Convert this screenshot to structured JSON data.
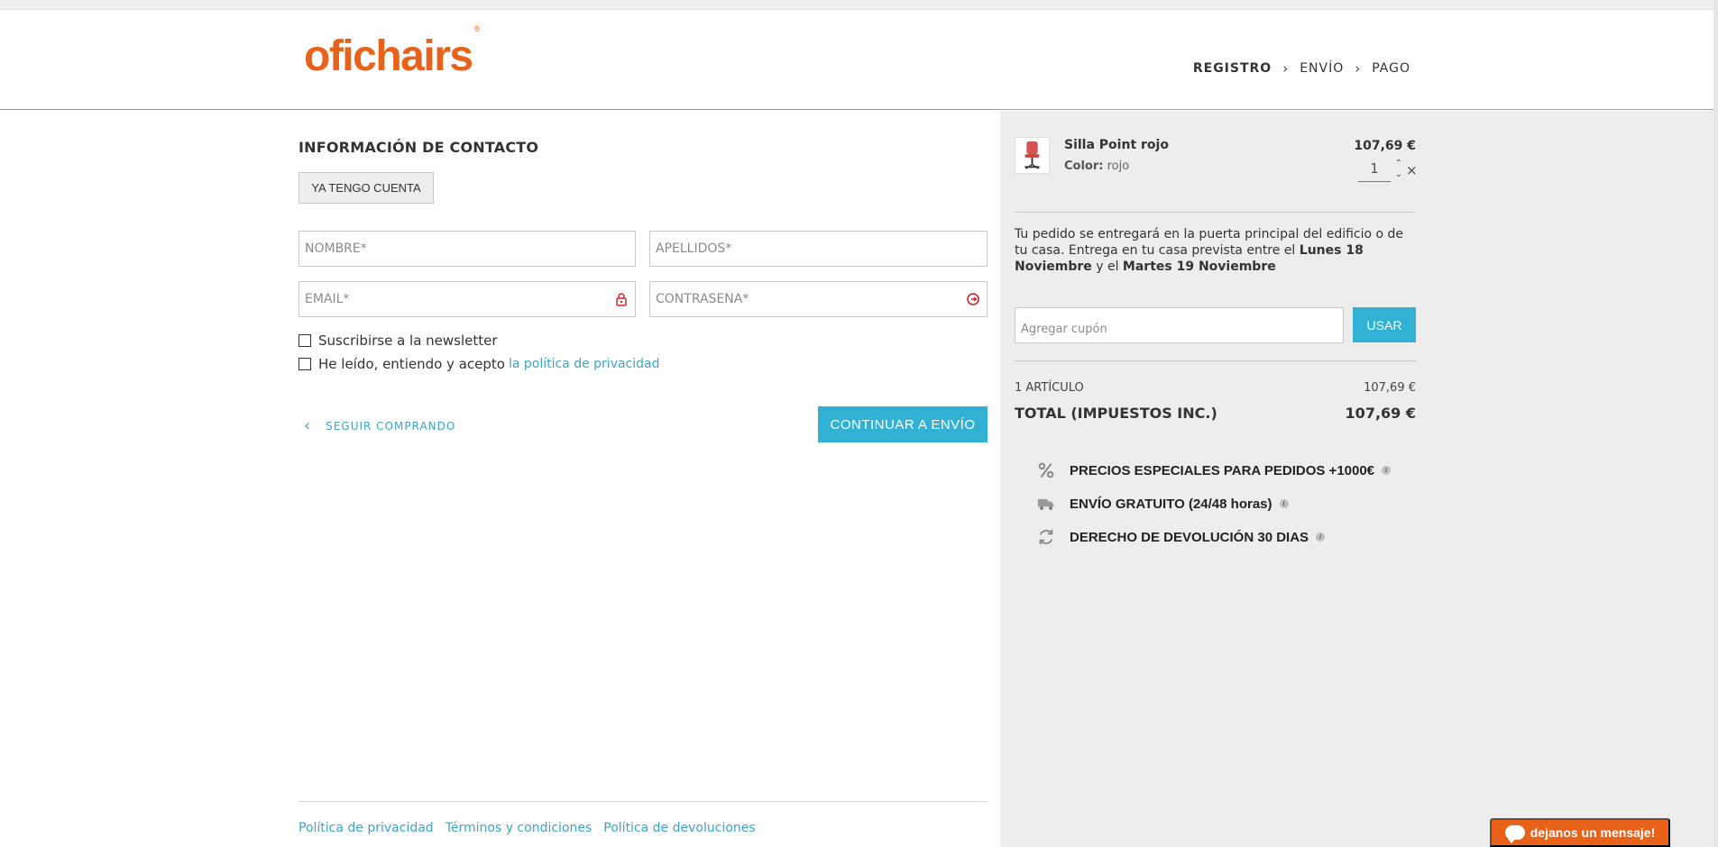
{
  "brand": {
    "logo_text": "ofichairs",
    "logo_mark": "®",
    "color": "#e8621a"
  },
  "steps": [
    {
      "label": "REGISTRO",
      "active": true
    },
    {
      "label": "ENVÍO",
      "active": false
    },
    {
      "label": "PAGO",
      "active": false
    }
  ],
  "contact": {
    "title": "INFORMACIÓN DE CONTACTO",
    "account_button": "YA TENGO CUENTA",
    "name_placeholder": "NOMBRE*",
    "surname_placeholder": "APELLIDOS*",
    "email_placeholder": "EMAIL*",
    "password_placeholder": "CONTRASEÑA*",
    "newsletter_label": "Suscribirse a la newsletter",
    "privacy_prefix": "He leído, entiendo y acepto",
    "privacy_link": "la política de privacidad",
    "back_label": "SEGUIR COMPRANDO",
    "continue_label": "CONTINUAR A ENVÍO"
  },
  "footer": {
    "links": [
      "Política de privacidad",
      "Términos y condiciones",
      "Política de devoluciones"
    ]
  },
  "cart": {
    "item": {
      "name": "Silla Point rojo",
      "color_label": "Color:",
      "color_value": "rojo",
      "price": "107,69 €",
      "quantity": "1",
      "remove": "×"
    },
    "delivery": {
      "text_1": "Tu pedido se entregará en la puerta principal del edificio o de tu casa. Entrega en tu casa prevista entre el",
      "date_1": "Lunes 18 Noviembre",
      "text_2": "y el",
      "date_2": "Martes 19 Noviembre"
    },
    "coupon_placeholder": "Agregar cupón",
    "coupon_button": "USAR",
    "summary_label": "1 ARTÍCULO",
    "summary_value": "107,69 €",
    "total_label": "TOTAL (IMPUESTOS INC.)",
    "total_value": "107,69 €"
  },
  "features": [
    {
      "icon": "percent-icon",
      "text": "PRECIOS ESPECIALES PARA PEDIDOS +1000€"
    },
    {
      "icon": "truck-icon",
      "text": "ENVÍO GRATUITO (24/48 horas)"
    },
    {
      "icon": "return-icon",
      "text": "DERECHO DE DEVOLUCIÓN 30 DIAS"
    }
  ],
  "chat": {
    "label": "dejanos un mensaje!"
  },
  "colors": {
    "accent": "#31b2d4",
    "brand": "#e8621a",
    "sidebar_bg": "#ededed"
  }
}
